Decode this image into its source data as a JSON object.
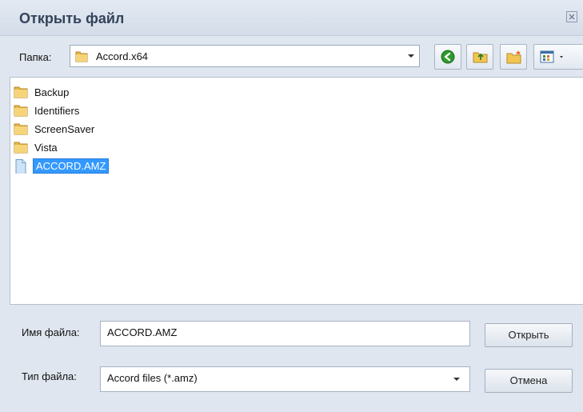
{
  "dialog": {
    "title": "Открыть файл",
    "close_icon": "close-icon"
  },
  "toolbar": {
    "folder_label": "Папка:",
    "folder_value": "Accord.x64",
    "buttons": [
      "back-icon",
      "up-folder-icon",
      "new-folder-icon",
      "view-menu-icon"
    ]
  },
  "files": [
    {
      "name": "Backup",
      "type": "folder"
    },
    {
      "name": "Identifiers",
      "type": "folder"
    },
    {
      "name": "ScreenSaver",
      "type": "folder"
    },
    {
      "name": "Vista",
      "type": "folder"
    },
    {
      "name": "ACCORD.AMZ",
      "type": "file",
      "selected": true
    }
  ],
  "form": {
    "filename_label": "Имя файла:",
    "filename_value": "ACCORD.AMZ",
    "filetype_label": "Тип файла:",
    "filetype_value": "Accord files (*.amz)",
    "open_button": "Открыть",
    "cancel_button": "Отмена"
  }
}
